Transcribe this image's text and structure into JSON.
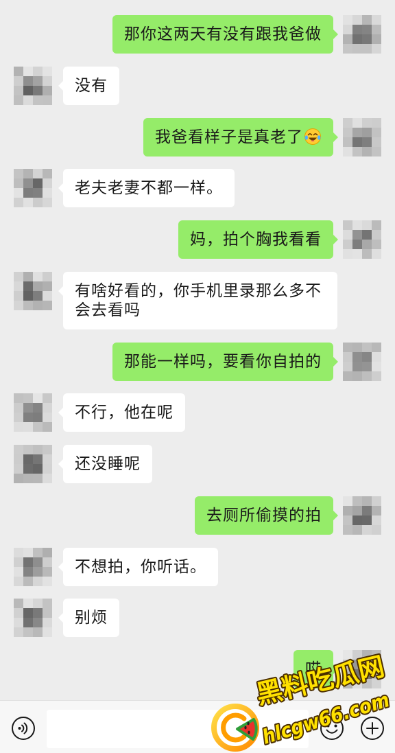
{
  "chat": {
    "messages": [
      {
        "outgoing": true,
        "text": "那你这两天有没有跟我爸做"
      },
      {
        "outgoing": false,
        "text": "没有"
      },
      {
        "outgoing": true,
        "text": "我爸看样子是真老了",
        "emoji": "tears-of-joy-emoji"
      },
      {
        "outgoing": false,
        "text": "老夫老妻不都一样。"
      },
      {
        "outgoing": true,
        "text": "妈，拍个胸我看看"
      },
      {
        "outgoing": false,
        "text": "有啥好看的，你手机里录那么多不会去看吗"
      },
      {
        "outgoing": true,
        "text": "那能一样吗，要看你自拍的"
      },
      {
        "outgoing": false,
        "text": "不行，他在呢"
      },
      {
        "outgoing": false,
        "text": "还没睡呢"
      },
      {
        "outgoing": true,
        "text": "去厕所偷摸的拍"
      },
      {
        "outgoing": false,
        "text": "不想拍，你听话。"
      },
      {
        "outgoing": false,
        "text": "别烦"
      },
      {
        "outgoing": true,
        "text": "哎"
      }
    ]
  },
  "input_bar": {
    "value": "",
    "voice_icon": "voice-icon",
    "emoji_icon": "emoji-icon",
    "plus_icon": "plus-icon"
  },
  "watermark": {
    "title": "黑料吃瓜网",
    "domain": "hlcgw66.com",
    "logo_icon": "watermelon-logo-icon"
  },
  "colors": {
    "chat_background": "#ededed",
    "outgoing_bubble": "#95ec69",
    "incoming_bubble": "#ffffff",
    "input_bar_background": "#f7f7f7",
    "watermark_text": "#ffe100"
  }
}
